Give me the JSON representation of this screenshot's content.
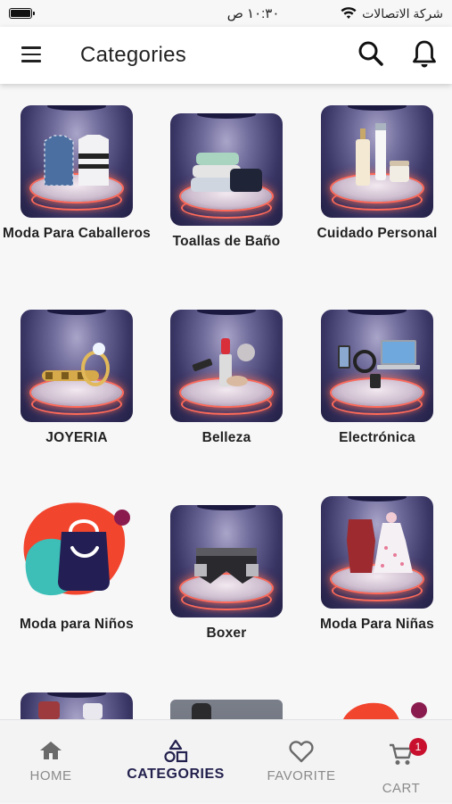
{
  "status_bar": {
    "time": "١٠:٣٠ ص",
    "carrier": "شركة الاتصالات"
  },
  "header": {
    "title": "Categories"
  },
  "categories": [
    {
      "label": "Moda Para Caballeros"
    },
    {
      "label": "Toallas de Baño"
    },
    {
      "label": "Cuidado Personal"
    },
    {
      "label": "JOYERIA"
    },
    {
      "label": "Belleza"
    },
    {
      "label": "Electrónica"
    },
    {
      "label": "Moda para Niños"
    },
    {
      "label": "Boxer"
    },
    {
      "label": "Moda Para Niñas"
    }
  ],
  "bottom_nav": {
    "items": [
      {
        "label": "HOME",
        "icon": "home-icon"
      },
      {
        "label": "CATEGORIES",
        "icon": "categories-icon"
      },
      {
        "label": "FAVORITE",
        "icon": "heart-icon"
      },
      {
        "label": "CART",
        "icon": "cart-icon"
      }
    ],
    "cart_badge": "1"
  },
  "colors": {
    "accent": "#23214d",
    "badge": "#c8102e",
    "stage_glow": "#ff6a5a",
    "kids_blob_red": "#f2452e",
    "kids_blob_teal": "#3dbfb8"
  }
}
